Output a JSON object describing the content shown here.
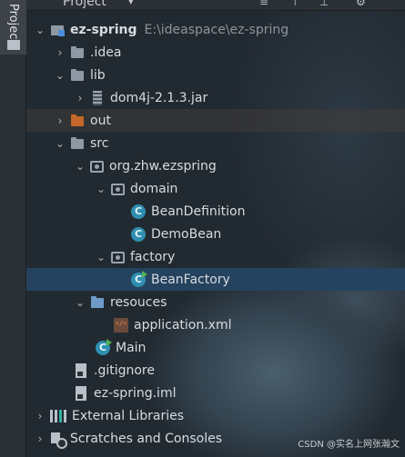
{
  "sidebar": {
    "tab_label": "Project"
  },
  "toolbar": {
    "title": "Project",
    "title_caret_icon": "chevron-down-icon",
    "icons": [
      "collapse-all-icon",
      "expand-icon",
      "scroll-from-source-icon",
      "gear-icon"
    ]
  },
  "tree": {
    "root": {
      "label": "ez-spring",
      "path": "E:\\ideaspace\\ez-spring"
    },
    "idea": ".idea",
    "lib": "lib",
    "jar": "dom4j-2.1.3.jar",
    "out": "out",
    "src": "src",
    "package": "org.zhw.ezspring",
    "domain": "domain",
    "bean_definition": "BeanDefinition",
    "demo_bean": "DemoBean",
    "factory": "factory",
    "bean_factory": "BeanFactory",
    "resouces": "resouces",
    "application_xml": "application.xml",
    "main": "Main",
    "gitignore": ".gitignore",
    "iml": "ez-spring.iml",
    "external_libraries": "External Libraries",
    "scratches": "Scratches and Consoles"
  },
  "class_icon_letter": "C",
  "watermark": "CSDN @实名上网张瀚文",
  "colors": {
    "selection": "#25435f",
    "class_icon": "#2f8fb0",
    "out_folder": "#c8682b",
    "resources_folder": "#6f9bc8"
  }
}
